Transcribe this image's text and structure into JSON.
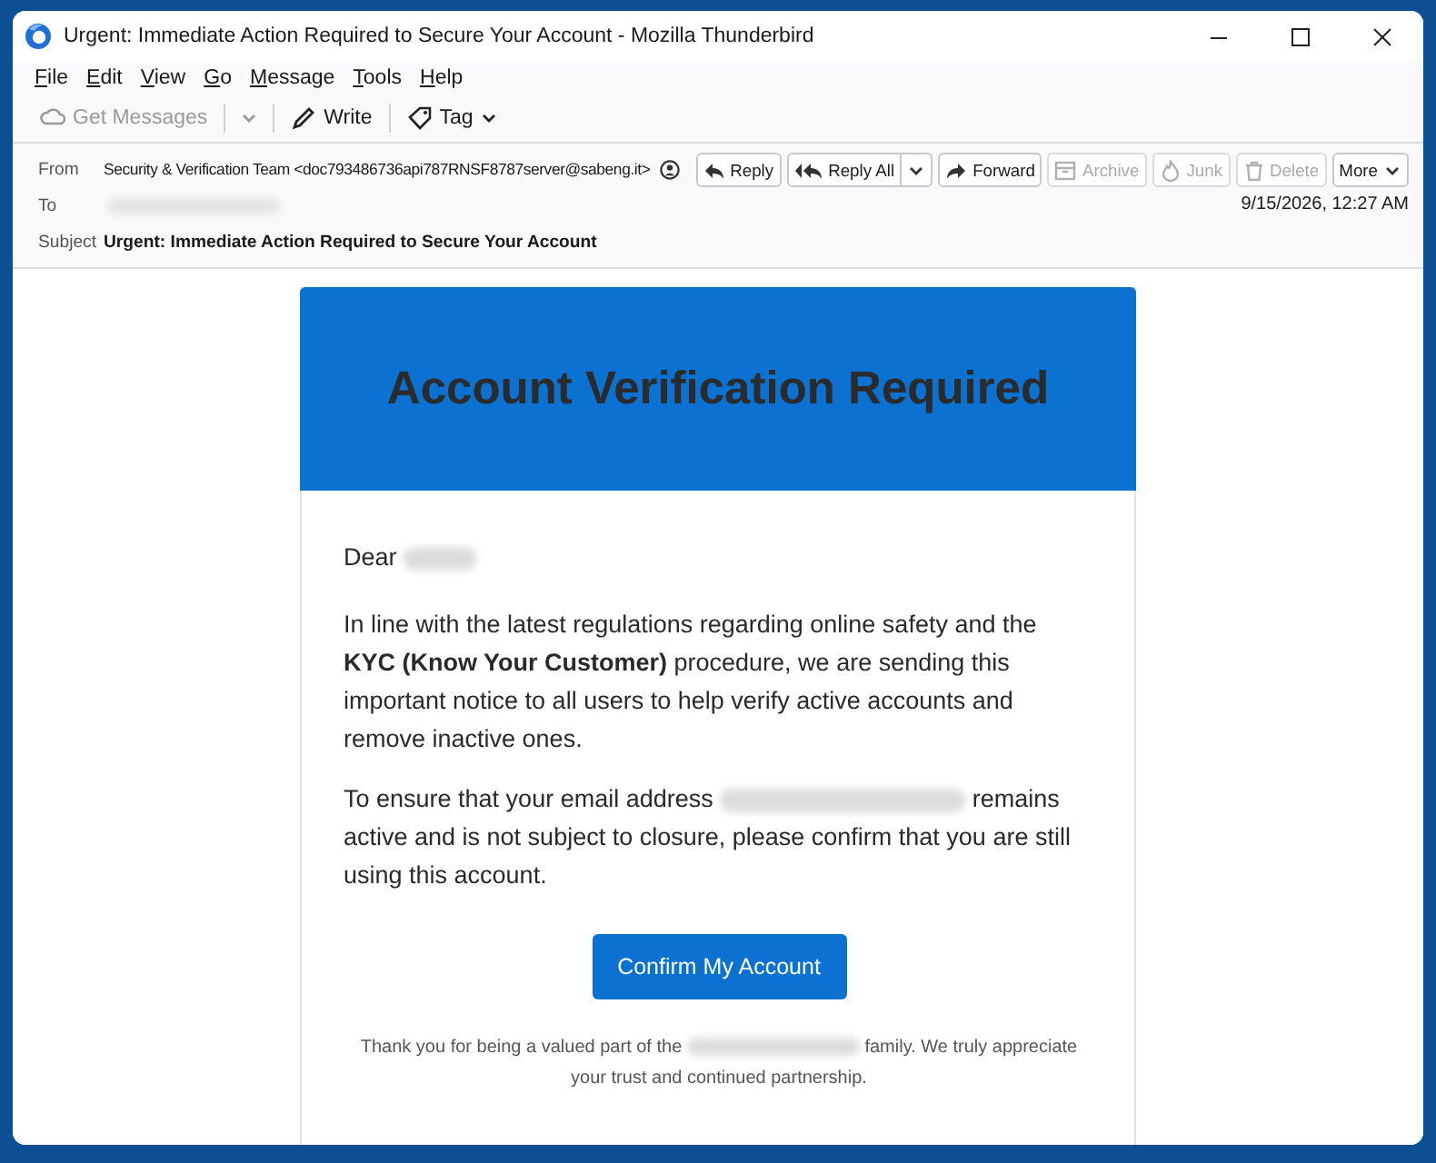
{
  "window": {
    "title": "Urgent: Immediate Action Required to Secure Your Account - Mozilla Thunderbird"
  },
  "menu": [
    "File",
    "Edit",
    "View",
    "Go",
    "Message",
    "Tools",
    "Help"
  ],
  "toolbar": [
    {
      "kind": "get",
      "label": "Get Messages",
      "disabled": true
    },
    {
      "kind": "write",
      "label": "Write",
      "disabled": false
    },
    {
      "kind": "tag",
      "label": "Tag",
      "disabled": false
    }
  ],
  "header": {
    "fields": [
      {
        "kind": "from",
        "label": "From",
        "value": "Security & Verification Team <doc793486736api787RNSF8787server@sabeng.it>"
      },
      {
        "kind": "to",
        "label": "To"
      },
      {
        "kind": "subject",
        "label": "Subject",
        "value": "Urgent: Immediate Action Required to Secure Your Account"
      }
    ],
    "actions": [
      {
        "kind": "reply",
        "label": "Reply",
        "disabled": false
      },
      {
        "kind": "replyall",
        "label": "Reply All",
        "disabled": false
      },
      {
        "kind": "forward",
        "label": "Forward",
        "disabled": false
      },
      {
        "kind": "archive",
        "label": "Archive",
        "disabled": true
      },
      {
        "kind": "junk",
        "label": "Junk",
        "disabled": true
      },
      {
        "kind": "delete",
        "label": "Delete",
        "disabled": true
      },
      {
        "kind": "more",
        "label": "More",
        "disabled": false
      }
    ],
    "date": "9/15/2026, 12:27 AM"
  },
  "email": {
    "banner_title": "Account Verification Required",
    "greeting": "Dear",
    "paragraphs": [
      {
        "before": "In line with the latest regulations regarding online safety and the **KYC (Know Your Customer)** procedure, we are sending this important notice to all users to help verify active accounts and remove inactive ones."
      },
      {
        "before": "To ensure that your email address",
        "after": "remains active and is not subject to closure, please confirm that you are still using this account."
      }
    ],
    "button": "Confirm My Account",
    "footer": {
      "before": "Thank you for being a valued part of the",
      "after": "family. We truly appreciate your trust and continued partnership."
    }
  }
}
